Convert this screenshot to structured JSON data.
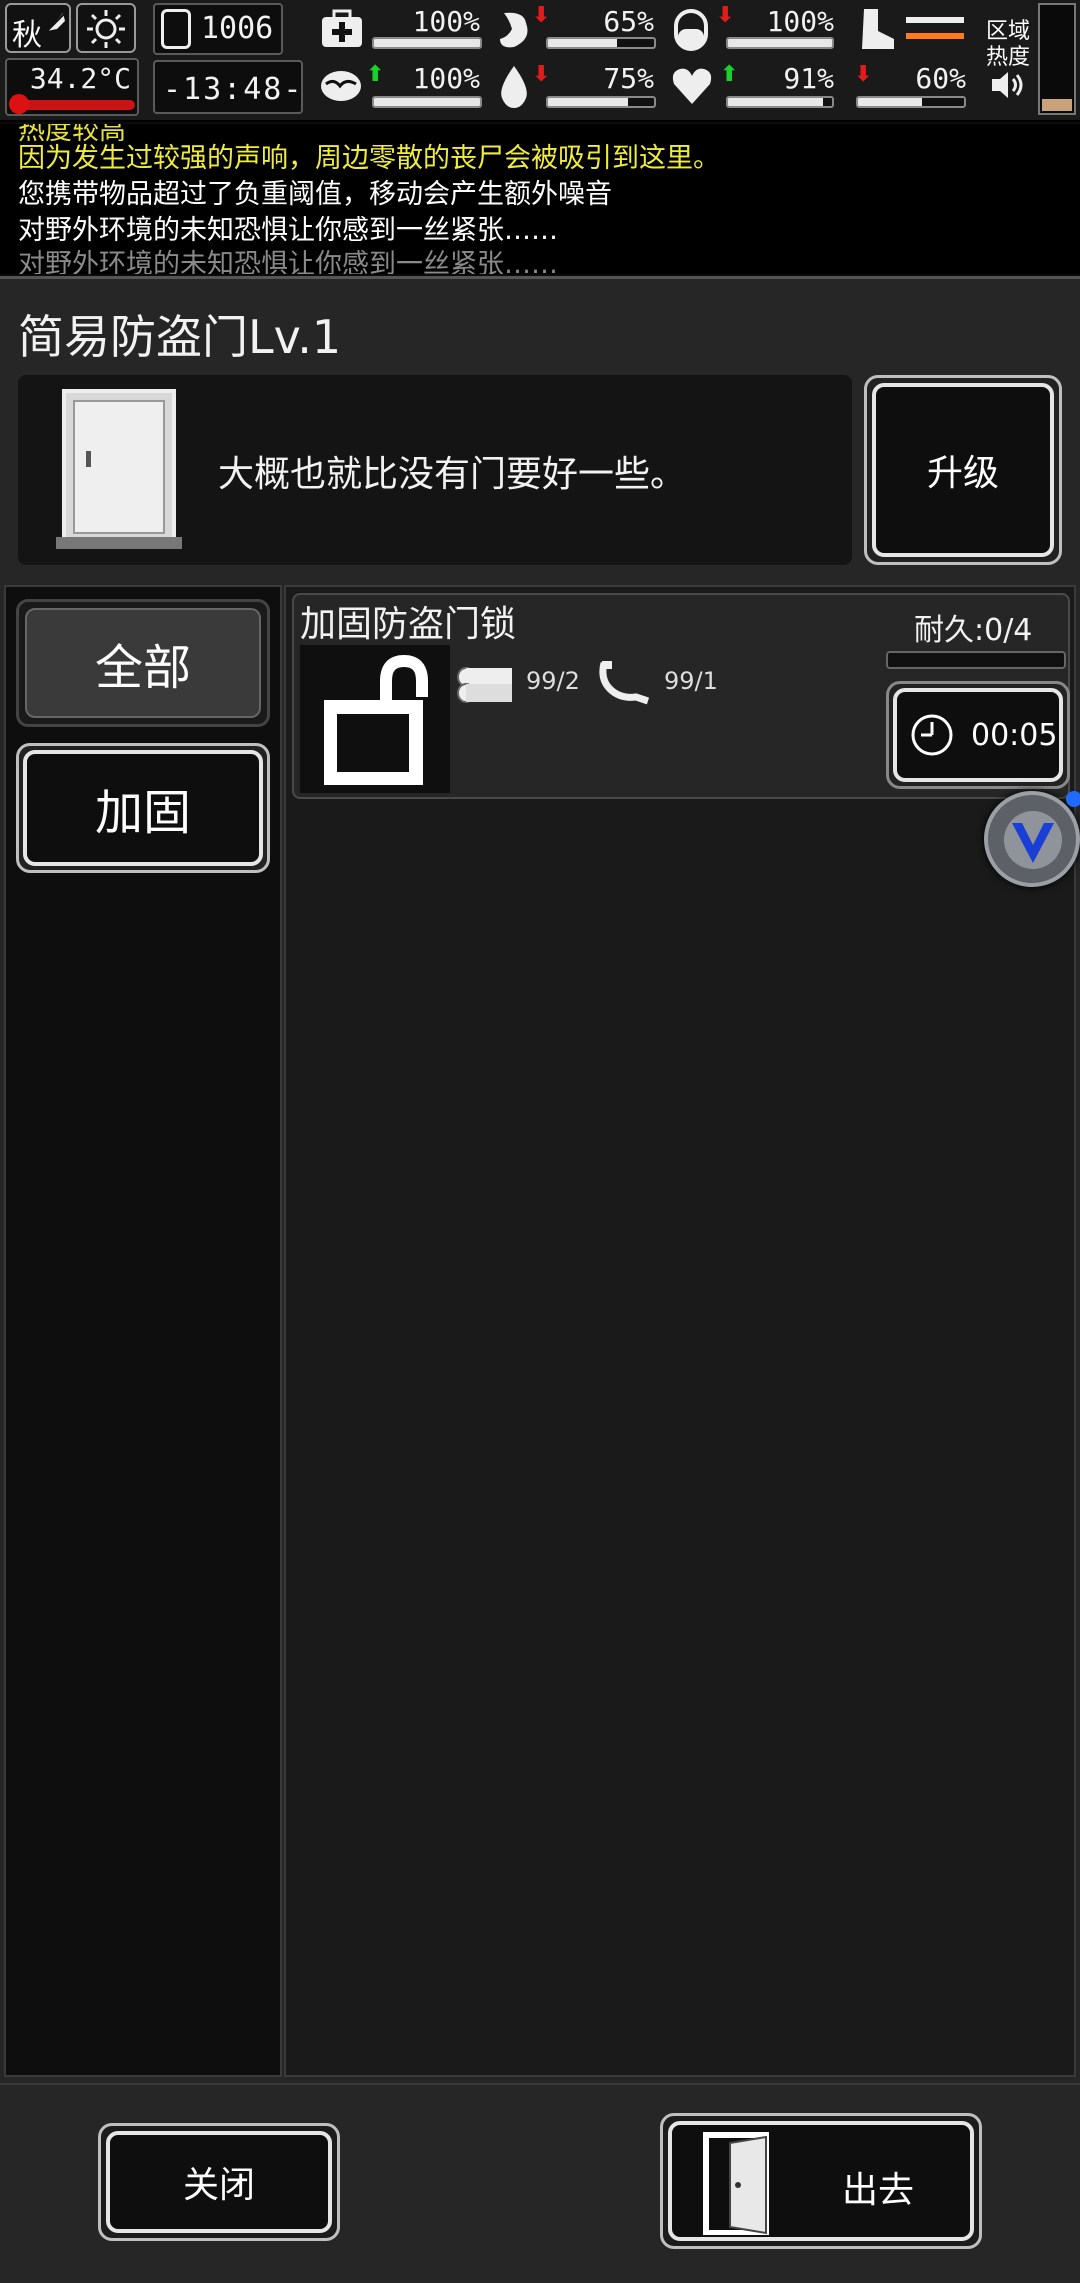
{
  "status_bar": {
    "season": "秋",
    "temperature": "34.2°C",
    "day_count": "1006",
    "time": "-13:48-",
    "area_heat_label_line1": "区域",
    "area_heat_label_line2": "热度",
    "stats": [
      {
        "name": "health",
        "value": "100%",
        "trend": "",
        "fill": 1.0
      },
      {
        "name": "hunger",
        "value": "65%",
        "trend": "down",
        "fill": 0.65
      },
      {
        "name": "energy",
        "value": "100%",
        "trend": "down",
        "fill": 1.0
      },
      {
        "name": "sanity",
        "value": "100%",
        "trend": "up",
        "fill": 1.0
      },
      {
        "name": "thirst",
        "value": "75%",
        "trend": "down",
        "fill": 0.75
      },
      {
        "name": "mood",
        "value": "91%",
        "trend": "up",
        "fill": 0.91
      },
      {
        "name": "stamina",
        "value": "60%",
        "trend": "down",
        "fill": 0.6
      }
    ],
    "weight_level": 0.5,
    "heat_level": 0.12
  },
  "message_log": [
    "热度较高",
    "因为发生过较强的声响，周边零散的丧尸会被吸引到这里。",
    "您携带物品超过了负重阈值，移动会产生额外噪音",
    "对野外环境的未知恐惧让你感到一丝紧张……",
    "对野外环境的未知恐惧让你感到一丝紧张……"
  ],
  "facility": {
    "title": "简易防盗门Lv.1",
    "description": "大概也就比没有门要好一些。",
    "upgrade_label": "升级"
  },
  "categories": [
    {
      "label": "全部",
      "selected": true
    },
    {
      "label": "加固",
      "selected": false
    }
  ],
  "recipes": [
    {
      "name": "加固防盗门锁",
      "durability": "耐久:0/4",
      "durability_fill": 0,
      "materials": [
        {
          "icon": "logs-icon",
          "amount": "99/2"
        },
        {
          "icon": "hose-icon",
          "amount": "99/1"
        }
      ],
      "time": "00:05"
    }
  ],
  "footer": {
    "close_label": "关闭",
    "exit_label": "出去"
  }
}
